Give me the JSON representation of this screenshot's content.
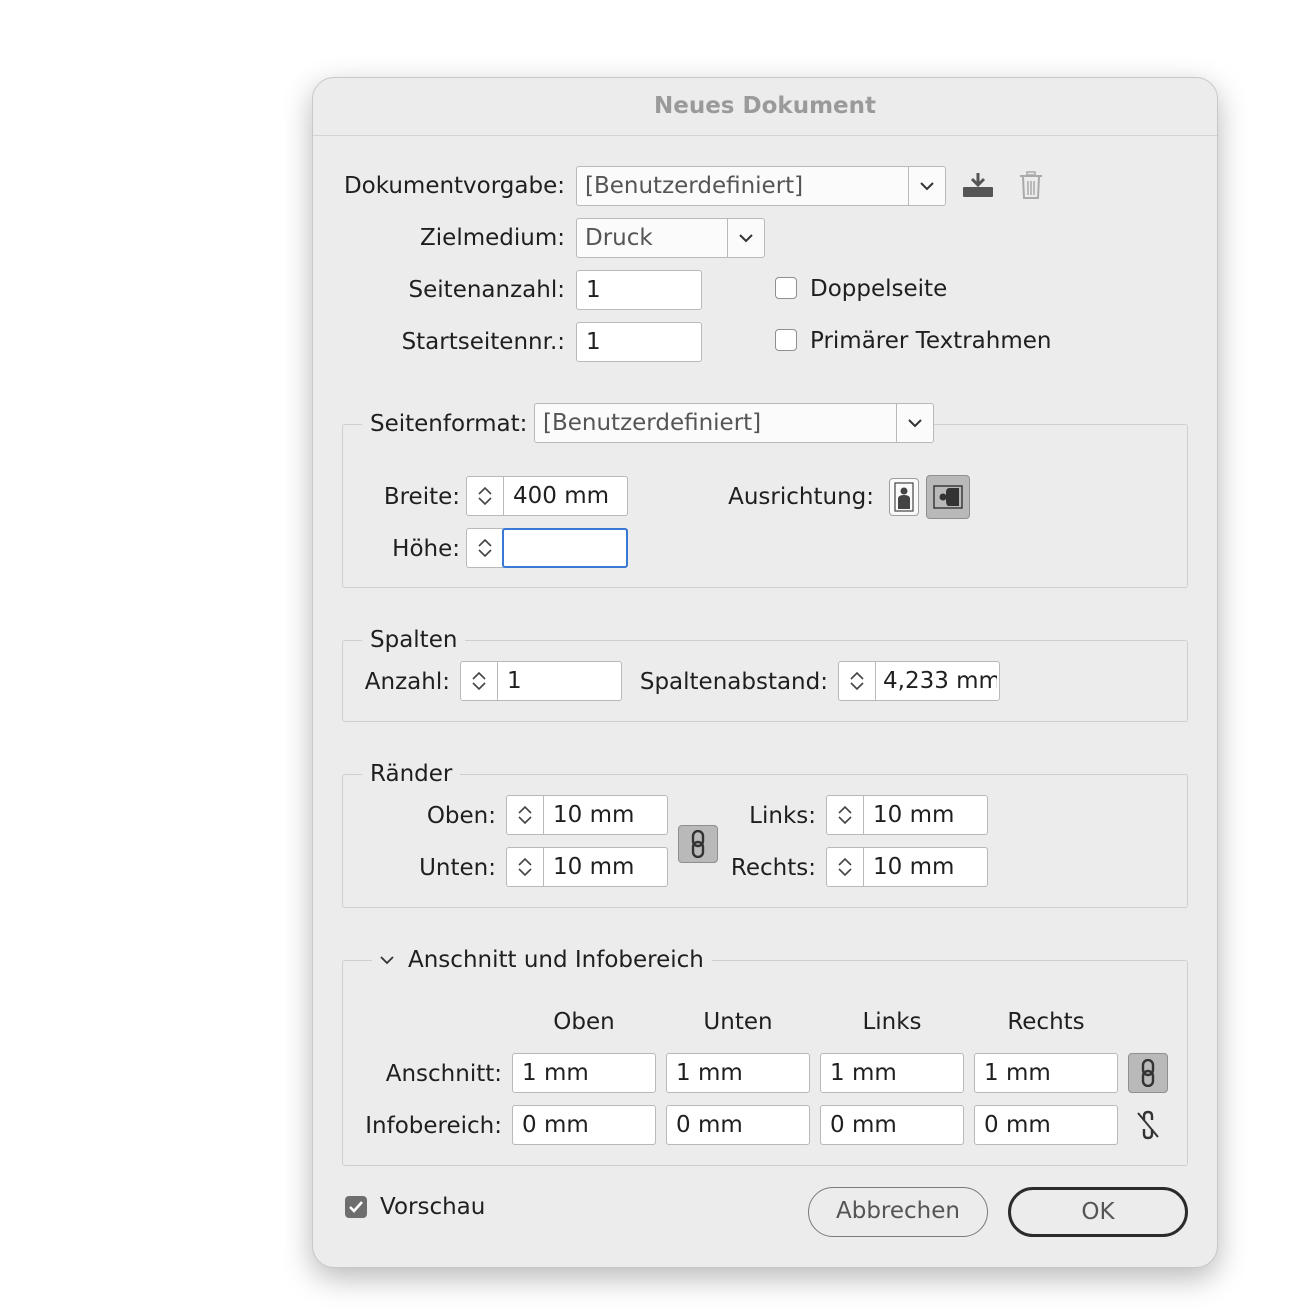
{
  "dialog": {
    "title": "Neues Dokument"
  },
  "general": {
    "preset_label": "Dokumentvorgabe:",
    "preset_value": "[Benutzerdefiniert]",
    "intent_label": "Zielmedium:",
    "intent_value": "Druck",
    "pages_label": "Seitenanzahl:",
    "pages_value": "1",
    "start_label": "Startseitennr.:",
    "start_value": "1",
    "facing_label": "Doppelseite",
    "facing_checked": false,
    "primary_frame_label": "Primärer Textrahmen",
    "primary_frame_checked": false
  },
  "page_size": {
    "label": "Seitenformat:",
    "value": "[Benutzerdefiniert]",
    "width_label": "Breite:",
    "width_value": "400 mm",
    "height_label": "Höhe:",
    "height_value": "",
    "orientation_label": "Ausrichtung:",
    "orientation_selected": "landscape"
  },
  "columns": {
    "legend": "Spalten",
    "number_label": "Anzahl:",
    "number_value": "1",
    "gutter_label": "Spaltenabstand:",
    "gutter_value": "4,233 mm"
  },
  "margins": {
    "legend": "Ränder",
    "top_label": "Oben:",
    "top_value": "10 mm",
    "bottom_label": "Unten:",
    "bottom_value": "10 mm",
    "left_label": "Links:",
    "left_value": "10 mm",
    "right_label": "Rechts:",
    "right_value": "10 mm",
    "linked": true
  },
  "bleed": {
    "legend": "Anschnitt und Infobereich",
    "columns": [
      "Oben",
      "Unten",
      "Links",
      "Rechts"
    ],
    "bleed_label": "Anschnitt:",
    "bleed_values": [
      "1 mm",
      "1 mm",
      "1 mm",
      "1 mm"
    ],
    "bleed_linked": true,
    "slug_label": "Infobereich:",
    "slug_values": [
      "0 mm",
      "0 mm",
      "0 mm",
      "0 mm"
    ],
    "slug_linked": false
  },
  "footer": {
    "preview_label": "Vorschau",
    "preview_checked": true,
    "cancel_label": "Abbrechen",
    "ok_label": "OK"
  },
  "icons": {
    "save_preset": "save-preset-icon",
    "delete_preset": "trash-icon",
    "chevron": "chevron-down-icon",
    "portrait": "portrait-orientation-icon",
    "landscape": "landscape-orientation-icon",
    "link": "chain-link-icon",
    "unlink": "broken-link-icon"
  },
  "colors": {
    "focus": "#3a78d6",
    "dialog_bg": "#ececec",
    "title": "#9a9a9a"
  }
}
